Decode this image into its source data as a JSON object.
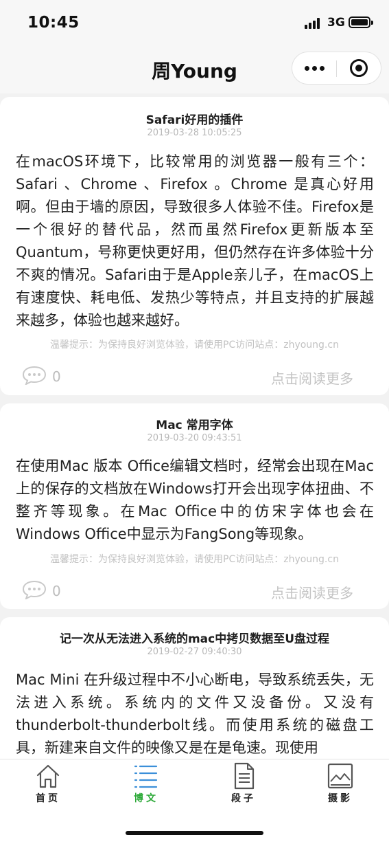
{
  "status_bar": {
    "time": "10:45",
    "network": "3G"
  },
  "nav": {
    "title": "周Young"
  },
  "posts": [
    {
      "title": "Safari好用的插件",
      "date": "2019-03-28 10:05:25",
      "excerpt": "在macOS环境下，比较常用的浏览器一般有三个：Safari 、Chrome 、Firefox 。Chrome 是真心好用啊。但由于墙的原因，导致很多人体验不佳。Firefox是一个很好的替代品，然而虽然Firefox更新版本至Quantum，号称更快更好用，但仍然存在许多体验十分不爽的情况。Safari由于是Apple亲儿子，在macOS上有速度快、耗电低、发热少等特点，并且支持的扩展越来越多，体验也越来越好。",
      "tip": "温馨提示：为保持良好浏览体验，请使用PC访问站点：zhyoung.cn",
      "comments": "0",
      "read_more": "点击阅读更多"
    },
    {
      "title": "Mac 常用字体",
      "date": "2019-03-20 09:43:51",
      "excerpt": "在使用Mac 版本 Office编辑文档时，经常会出现在Mac上的保存的文档放在Windows打开会出现字体扭曲、不整齐等现象。在Mac Office中的仿宋字体也会在Windows Office中显示为FangSong等现象。",
      "tip": "温馨提示：为保持良好浏览体验，请使用PC访问站点：zhyoung.cn",
      "comments": "0",
      "read_more": "点击阅读更多"
    },
    {
      "title": "记一次从无法进入系统的mac中拷贝数据至U盘过程",
      "date": "2019-02-27 09:40:30",
      "excerpt": "Mac Mini 在升级过程中不小心断电，导致系统丢失，无法进入系统。系统内的文件又没备份。又没有thunderbolt-thunderbolt线。而使用系统的磁盘工具，新建来自文件的映像又是在是龟速。现使用"
    }
  ],
  "tabs": [
    {
      "label": "首页",
      "icon": "home-icon"
    },
    {
      "label": "博文",
      "icon": "list-icon"
    },
    {
      "label": "段子",
      "icon": "document-icon"
    },
    {
      "label": "摄影",
      "icon": "photo-icon"
    }
  ],
  "colors": {
    "active_tab": "#2eaa3a",
    "background": "#f2f2f2",
    "card": "#ffffff"
  }
}
